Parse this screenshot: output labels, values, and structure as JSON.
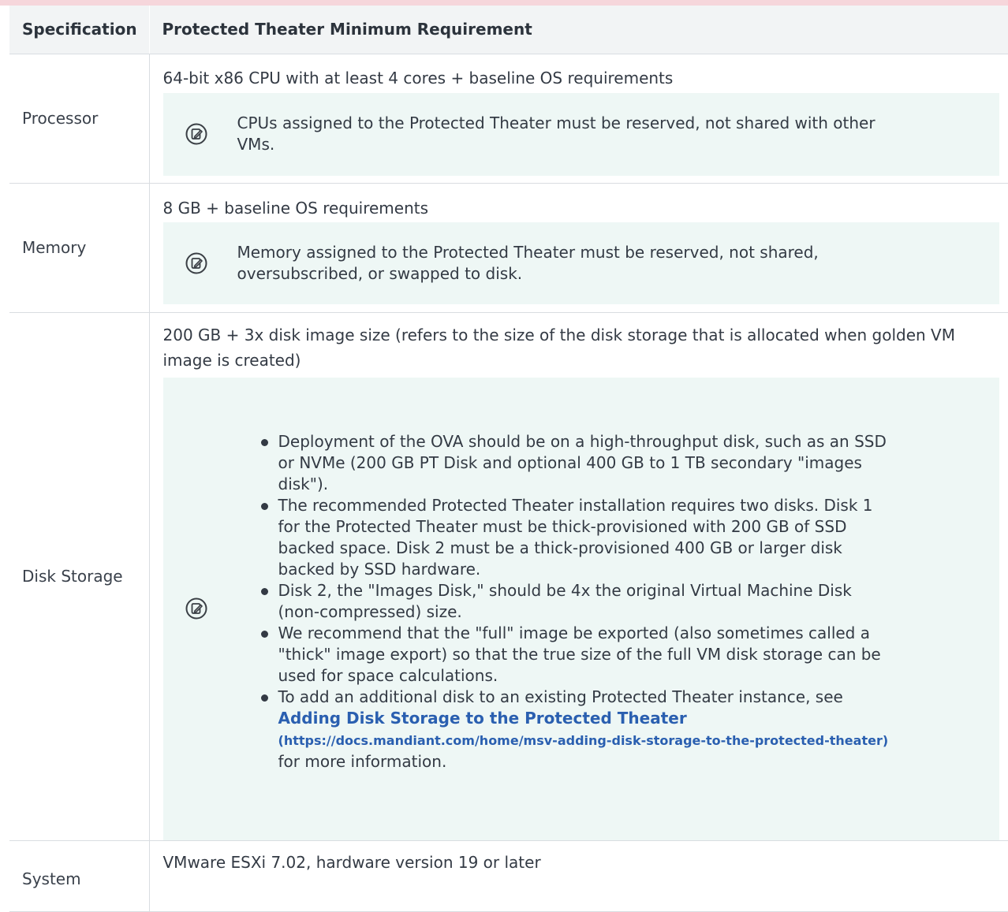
{
  "table": {
    "headers": {
      "spec": "Specification",
      "req": "Protected Theater Minimum Requirement"
    },
    "rows": [
      {
        "spec": "Processor",
        "req": "64-bit x86 CPU with at least 4 cores + baseline OS requirements",
        "note": "CPUs assigned to the Protected Theater must be reserved, not shared with other VMs."
      },
      {
        "spec": "Memory",
        "req": "8 GB + baseline OS requirements",
        "note": "Memory assigned to the Protected Theater must be reserved, not shared, oversubscribed, or swapped to disk."
      },
      {
        "spec": "Disk Storage",
        "req": "200 GB + 3x disk image size (refers to the size of the disk storage that is allocated when golden VM image is created)",
        "bullets": [
          "Deployment of the OVA should be on a high-throughput disk, such as an SSD or NVMe (200 GB PT Disk and optional 400 GB to 1 TB secondary \"images disk\").",
          "The recommended Protected Theater installation requires two disks. Disk 1 for the Protected Theater must be thick-provisioned with 200 GB of SSD backed space. Disk 2 must be a thick-provisioned 400 GB or larger disk backed by SSD hardware.",
          "Disk 2, the \"Images Disk,\" should be 4x the original Virtual Machine Disk (non-compressed) size.",
          "We recommend that the \"full\" image be exported (also sometimes called a \"thick\" image export) so that the true size of the full VM disk storage can be used for space calculations."
        ],
        "last_bullet": {
          "prefix": "To add an additional disk to an existing Protected Theater instance, see",
          "link_title": "Adding Disk Storage to the Protected Theater",
          "link_url": "(https://docs.mandiant.com/home/msv-adding-disk-storage-to-the-protected-theater)",
          "suffix": "for more information."
        }
      },
      {
        "spec": "System",
        "req": "VMware ESXi 7.02, hardware version 19 or later"
      }
    ]
  },
  "note_icon": "note-edit-icon",
  "colors": {
    "note_background": "#eef7f5",
    "header_background": "#f2f4f5",
    "link": "#2a5fb0",
    "top_strip": "#f6d6db"
  }
}
